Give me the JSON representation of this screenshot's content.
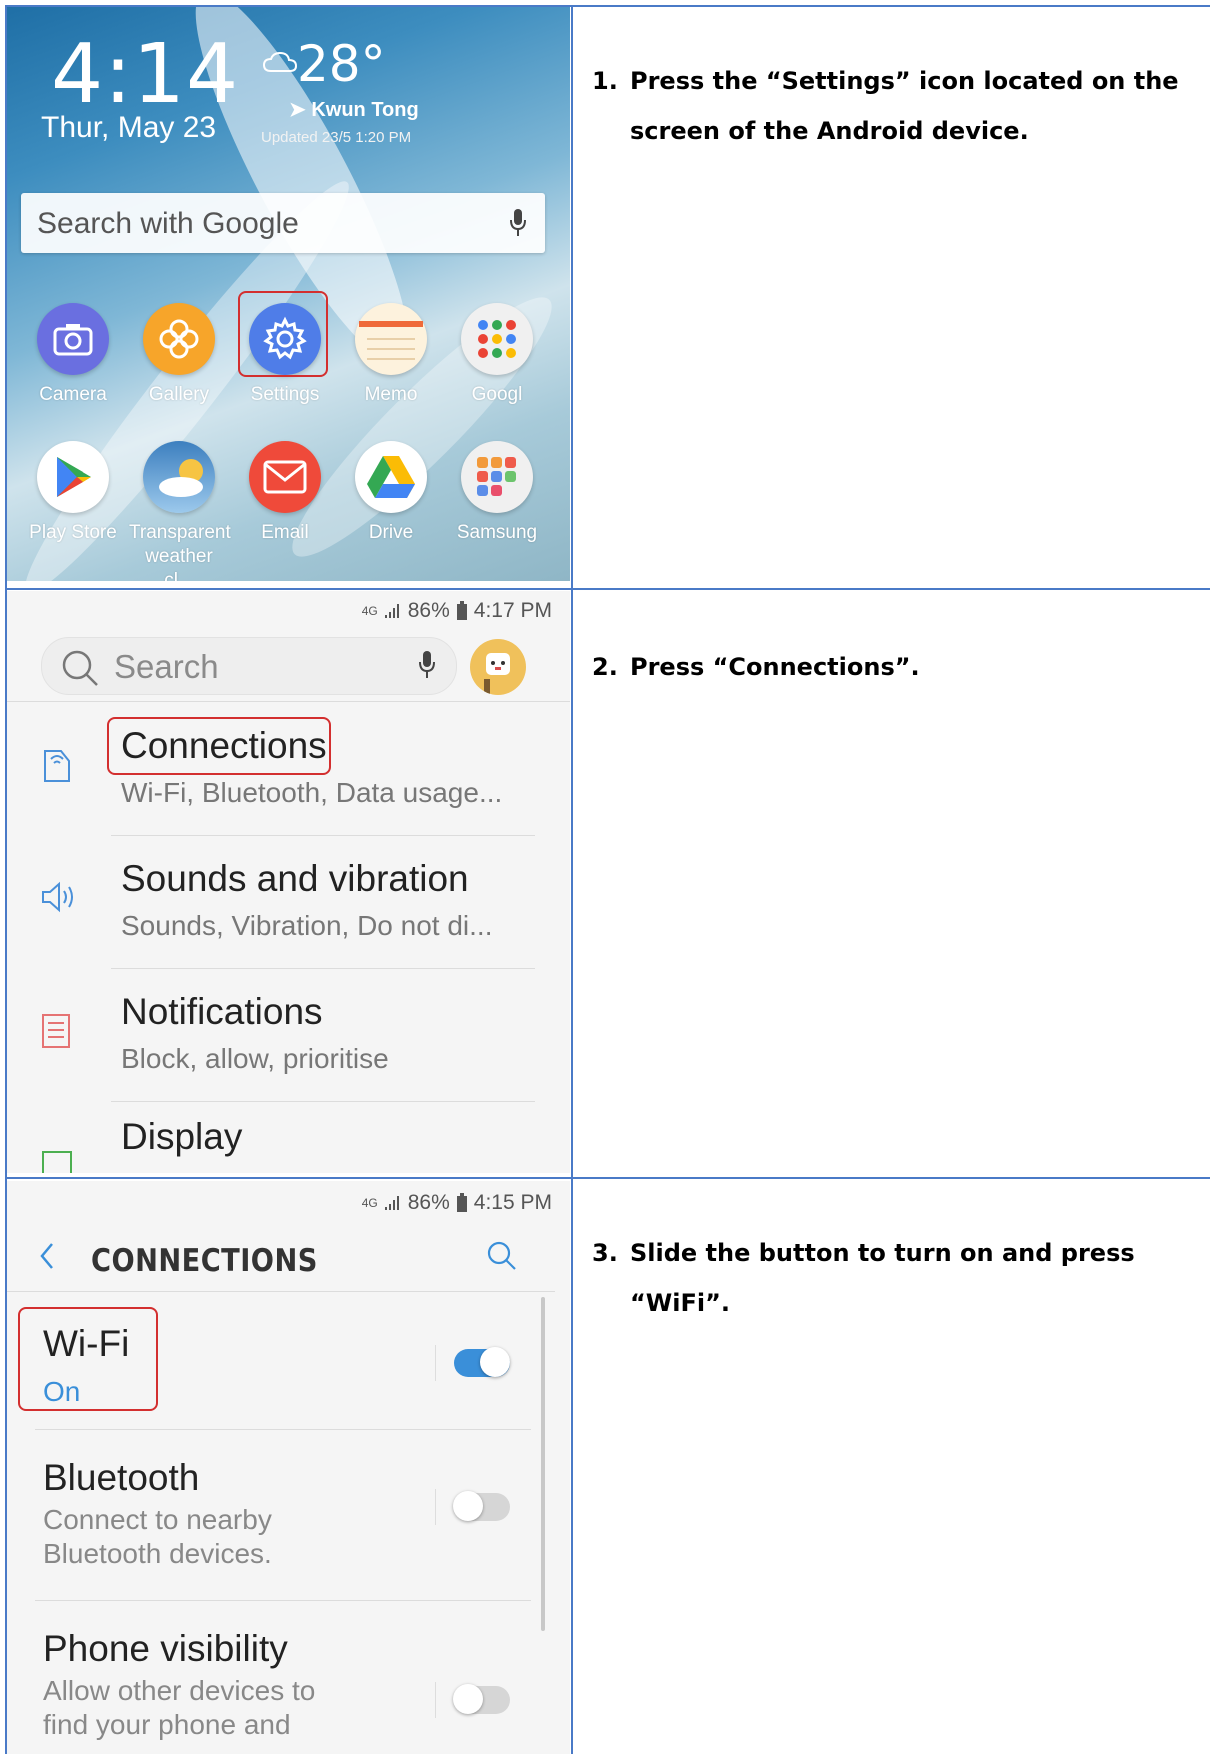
{
  "steps": [
    {
      "number": "1.",
      "text": "Press the “Settings” icon located on the screen of the Android device."
    },
    {
      "number": "2.",
      "text": "Press “Connections”."
    },
    {
      "number": "3.",
      "text": "Slide the button to turn on and press “WiFi”."
    }
  ],
  "home_screen": {
    "time": "4:14",
    "date": "Thur, May 23",
    "weather": {
      "temp": "28°",
      "location": "Kwun Tong",
      "updated": "Updated 23/5 1:20 PM"
    },
    "search_placeholder": "Search with Google",
    "apps_row1": [
      {
        "label": "Camera",
        "icon": "camera-icon",
        "color": "#6a6fe0"
      },
      {
        "label": "Gallery",
        "icon": "gallery-flower-icon",
        "color": "#f7a52a"
      },
      {
        "label": "Settings",
        "icon": "gear-icon",
        "color": "#4f7de8"
      },
      {
        "label": "Memo",
        "icon": "memo-notepad-icon",
        "color": "#fdf2dd"
      },
      {
        "label": "Googl",
        "icon": "google-folder-icon",
        "color": "#f0f0f0"
      }
    ],
    "apps_row2": [
      {
        "label": "Play Store",
        "icon": "play-store-icon",
        "color": "#ffffff"
      },
      {
        "label": "Transparent weather cl...",
        "icon": "weather-clock-icon",
        "color": "#6aa8d8"
      },
      {
        "label": "Email",
        "icon": "email-envelope-icon",
        "color": "#ef4a3a"
      },
      {
        "label": "Drive",
        "icon": "google-drive-icon",
        "color": "#ffffff"
      },
      {
        "label": "Samsung",
        "icon": "samsung-folder-icon",
        "color": "#f0f0f0"
      }
    ]
  },
  "settings_screen": {
    "status": {
      "network": "4G",
      "battery": "86%",
      "time": "4:17 PM"
    },
    "search_placeholder": "Search",
    "items": [
      {
        "title": "Connections",
        "subtitle": "Wi-Fi, Bluetooth, Data usage...",
        "icon": "connections-icon"
      },
      {
        "title": "Sounds and vibration",
        "subtitle": "Sounds, Vibration, Do not di...",
        "icon": "speaker-icon"
      },
      {
        "title": "Notifications",
        "subtitle": "Block, allow, prioritise",
        "icon": "notifications-icon"
      },
      {
        "title": "Display",
        "subtitle": "",
        "icon": "display-icon"
      }
    ]
  },
  "connections_screen": {
    "status": {
      "network": "4G",
      "battery": "86%",
      "time": "4:15 PM"
    },
    "header": "CONNECTIONS",
    "items": [
      {
        "title": "Wi-Fi",
        "subtitle": "On",
        "toggle_on": true
      },
      {
        "title": "Bluetooth",
        "subtitle": "Connect to nearby Bluetooth devices.",
        "toggle_on": false
      },
      {
        "title": "Phone visibility",
        "subtitle": "Allow other devices to find your phone and",
        "toggle_on": false
      }
    ],
    "accent": "#3a8fd9"
  }
}
